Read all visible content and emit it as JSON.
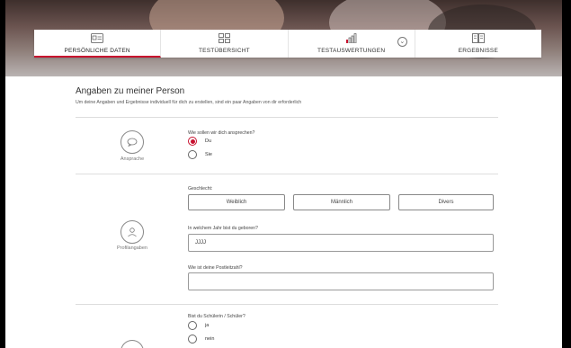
{
  "nav": {
    "tabs": [
      {
        "label": "PERSÖNLICHE DATEN",
        "icon": "id-card-icon",
        "active": true
      },
      {
        "label": "TESTÜBERSICHT",
        "icon": "grid-icon",
        "active": false
      },
      {
        "label": "TESTAUSWERTUNGEN",
        "icon": "bar-chart-icon",
        "active": false
      },
      {
        "label": "ERGEBNISSE",
        "icon": "book-icon",
        "active": false
      }
    ]
  },
  "page": {
    "title": "Angaben zu meiner Person",
    "subtitle": "Um deine Angaben und Ergebnisse individuell für dich zu erstellen, sind ein paar Angaben von dir erforderlich"
  },
  "ansprache": {
    "section_label": "Ansprache",
    "question": "Wie sollen wir dich ansprechen?",
    "options": [
      {
        "label": "Du",
        "selected": true
      },
      {
        "label": "Sie",
        "selected": false
      }
    ]
  },
  "profil": {
    "section_label": "Profilangaben",
    "gender_label": "Geschlecht:",
    "gender_options": [
      "Weiblich",
      "Männlich",
      "Divers"
    ],
    "birth_question": "In welchem Jahr bist du geboren?",
    "birth_value": "JJJJ",
    "zip_question": "Wie ist deine Postleitzahl?",
    "zip_value": ""
  },
  "schueler": {
    "question": "Bist du Schülerin / Schüler?",
    "options": [
      {
        "label": "ja",
        "selected": false
      },
      {
        "label": "nein",
        "selected": false
      }
    ]
  },
  "colors": {
    "accent": "#c8102e"
  }
}
